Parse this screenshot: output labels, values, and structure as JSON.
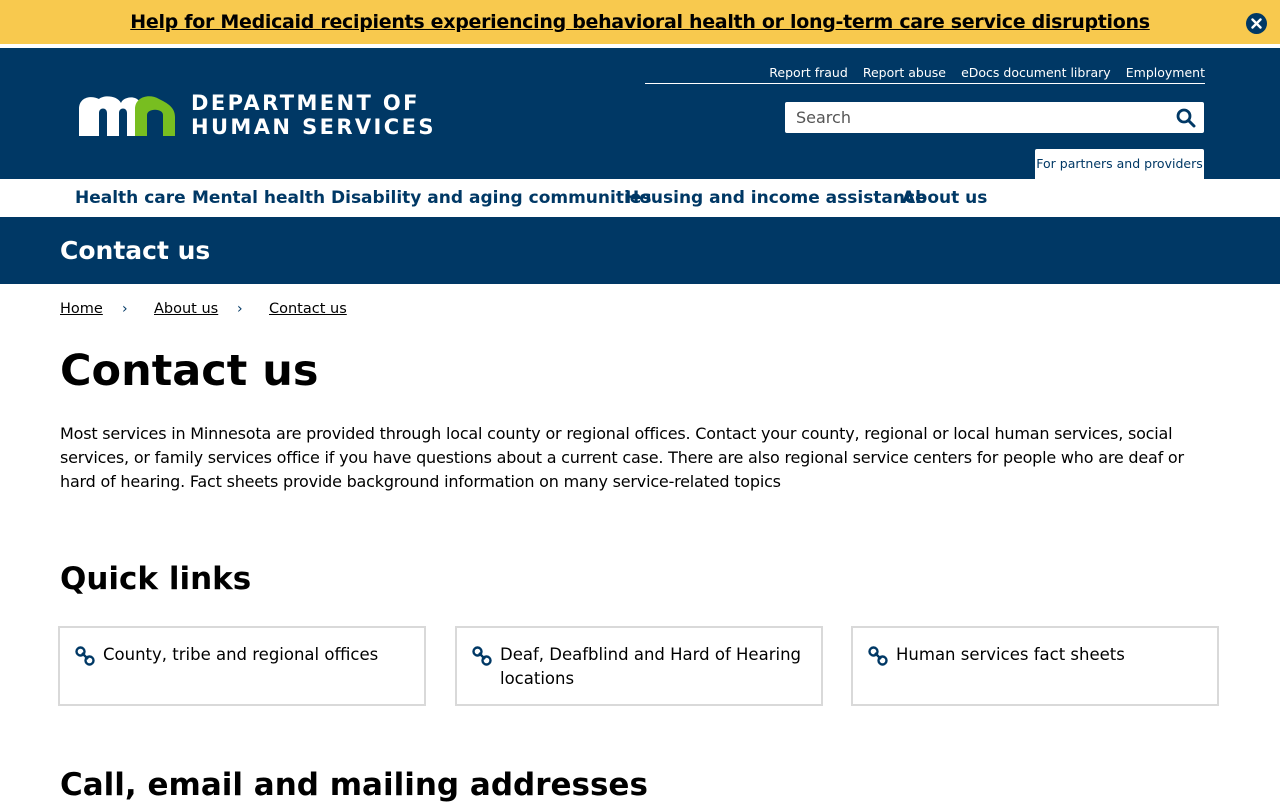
{
  "alert": {
    "text": "Help for Medicaid recipients experiencing behavioral health or long-term care service disruptions",
    "close_icon": "close-circle-icon"
  },
  "header": {
    "logo_line1": "DEPARTMENT OF",
    "logo_line2": "HUMAN SERVICES",
    "utility_links": [
      "Report fraud",
      "Report abuse",
      "eDocs document library",
      "Employment"
    ],
    "search_placeholder": "Search",
    "search_icon": "search-icon",
    "partners_link": "For partners and providers"
  },
  "colors": {
    "brand": "#003865",
    "accent_green": "#78be20",
    "alert": "#f8c94e"
  },
  "nav": [
    "Health care",
    "Mental health",
    "Disability and aging communities",
    "Housing and income assistance",
    "About us"
  ],
  "title_band": "Contact us",
  "breadcrumb": {
    "items": [
      "Home",
      "About us",
      "Contact us"
    ],
    "separator": "›"
  },
  "page": {
    "title": "Contact us",
    "intro": "Most services in Minnesota are provided through local county or regional offices. Contact your county, regional or local human services, social services, or family services office if you have questions about a current case. There are also regional service centers for people who are deaf or hard of hearing. Fact sheets provide background information on many service-related topics",
    "quick_links_heading": "Quick links",
    "quick_links": [
      {
        "label": "County, tribe and regional offices",
        "icon": "link-icon"
      },
      {
        "label": "Deaf, Deafblind and Hard of Hearing locations",
        "icon": "link-icon"
      },
      {
        "label": "Human services fact sheets",
        "icon": "link-icon"
      }
    ],
    "next_heading": "Call, email and mailing addresses"
  }
}
